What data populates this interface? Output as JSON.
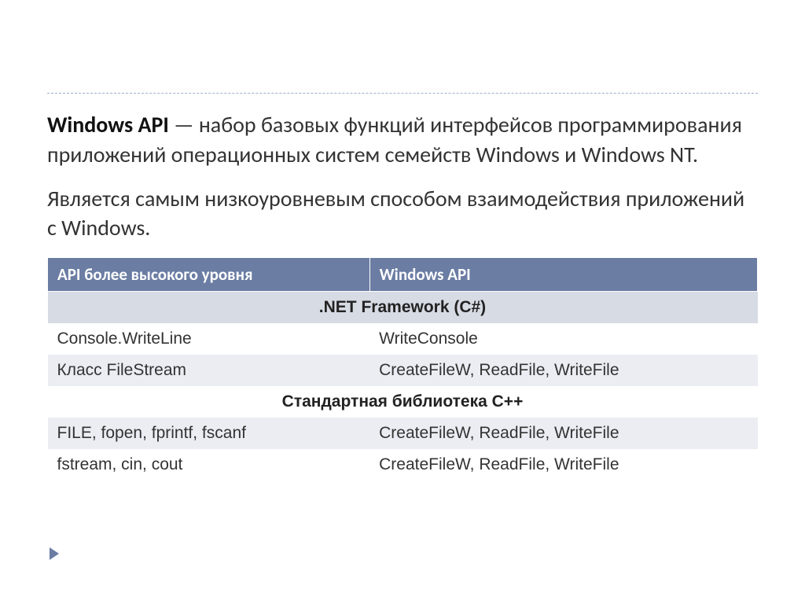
{
  "paragraph1": {
    "bold": "Windows API",
    "rest": "  — набор базовых функций интерфейсов программирования приложений операционных систем семейств Windows и Windows NT."
  },
  "paragraph2": "Является самым низкоуровневым способом взаимодействия приложений с Windows.",
  "table": {
    "headers": {
      "col1": "API более высокого уровня",
      "col2": "Windows API"
    },
    "section1": ".NET Framework (C#)",
    "rows1": [
      {
        "c1": "Console.WriteLine",
        "c2": "WriteConsole"
      },
      {
        "c1": "Класс FileStream",
        "c2": "CreateFileW, ReadFile, WriteFile"
      }
    ],
    "section2": "Стандартная библиотека C++",
    "rows2": [
      {
        "c1": "FILE, fopen, fprintf, fscanf",
        "c2": "CreateFileW, ReadFile, WriteFile"
      },
      {
        "c1": "fstream, cin, cout",
        "c2": "CreateFileW, ReadFile, WriteFile"
      }
    ]
  }
}
